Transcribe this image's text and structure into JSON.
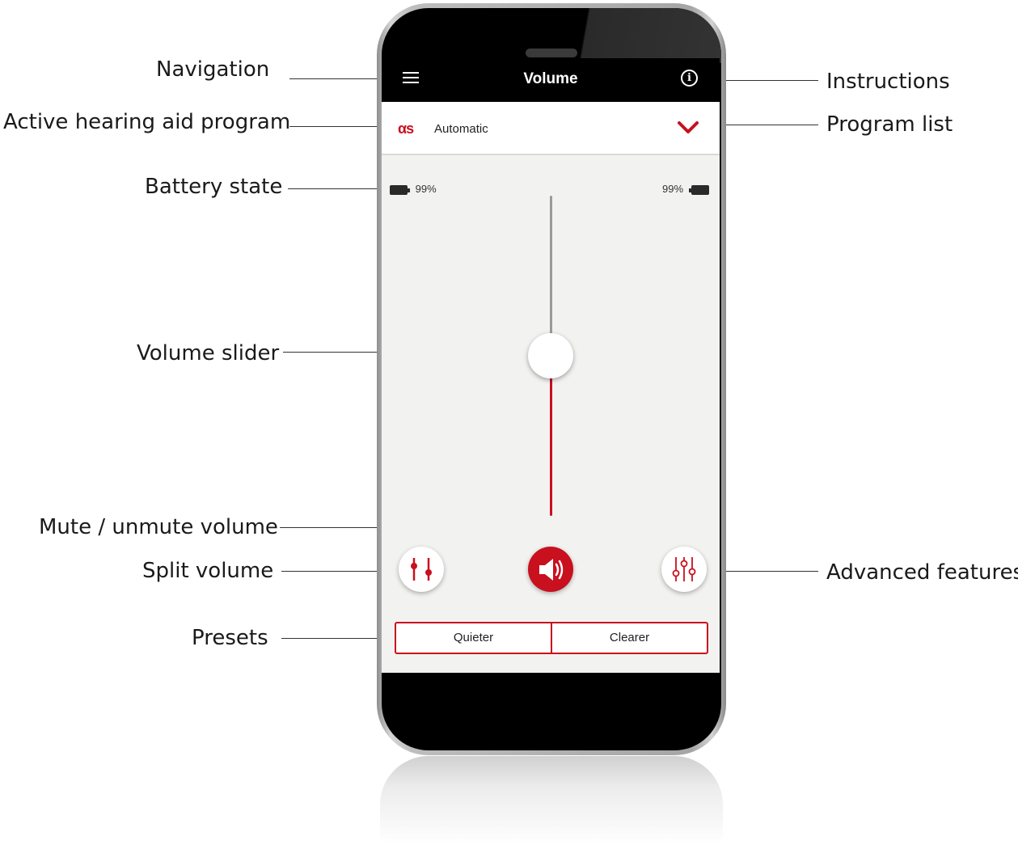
{
  "annotations": {
    "navigation": "Navigation",
    "active_program": "Active hearing aid program",
    "battery_state": "Battery state",
    "volume_slider": "Volume slider",
    "mute_unmute": "Mute / unmute volume",
    "split_volume": "Split volume",
    "presets": "Presets",
    "instructions": "Instructions",
    "program_list": "Program list",
    "advanced_features": "Advanced features"
  },
  "app_bar": {
    "title": "Volume",
    "menu_icon": "hamburger-menu-icon",
    "info_icon": "info-icon",
    "info_glyph": "i"
  },
  "program": {
    "icon_text": "αs",
    "name": "Automatic",
    "chevron_icon": "chevron-down-icon"
  },
  "battery": {
    "left": "99%",
    "right": "99%"
  },
  "volume": {
    "level": 0.5
  },
  "controls": {
    "split_icon": "split-volume-icon",
    "mute_icon": "speaker-icon",
    "advanced_icon": "equalizer-icon"
  },
  "presets": [
    "Quieter",
    "Clearer"
  ],
  "colors": {
    "accent": "#c8101e",
    "app_bar": "#000000",
    "screen_bg": "#f2f2f0"
  }
}
